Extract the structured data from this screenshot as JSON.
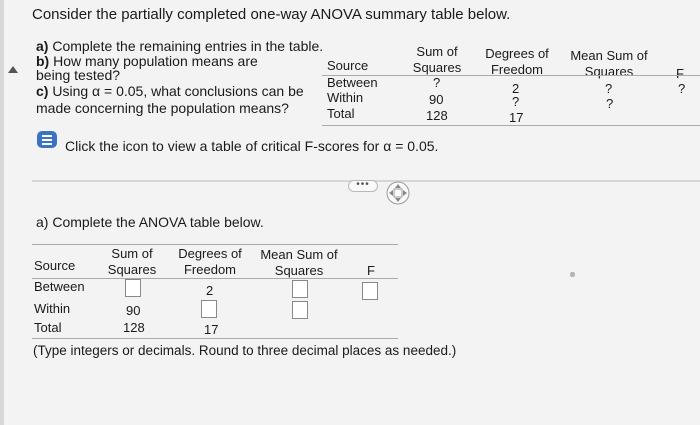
{
  "question": {
    "title": "Consider the partially completed one-way ANOVA summary table below.",
    "part_a_label": "a)",
    "part_a": "Complete the remaining entries in the table.",
    "part_b_label": "b)",
    "part_b_1": "How many population means are",
    "part_b_2": "being tested?",
    "part_c_label": "c)",
    "part_c_1": "Using α = 0.05, what conclusions can be",
    "part_c_2": "made concerning the population means?"
  },
  "summary_table": {
    "col_source": "Source",
    "col_ss_1": "Sum of",
    "col_ss_2": "Squares",
    "col_df_1": "Degrees of",
    "col_df_2": "Freedom",
    "col_ms_1": "Mean Sum of",
    "col_ms_2": "Squares",
    "col_f": "F",
    "rows": [
      {
        "source": "Between",
        "ss": "?",
        "df": "2",
        "ms": "?",
        "f": "?"
      },
      {
        "source": "Within",
        "ss": "90",
        "df": "?",
        "ms": "?"
      },
      {
        "source": "Total",
        "ss": "128",
        "df": "17"
      }
    ]
  },
  "info": {
    "icon": "table-icon",
    "text": "Click the icon to view a table of critical F-scores for α = 0.05."
  },
  "toolbar": {
    "dots_label": "•••",
    "move_icon": "move-icon"
  },
  "answer": {
    "title": "a) Complete the ANOVA table below.",
    "col_source": "Source",
    "col_ss_1": "Sum of",
    "col_ss_2": "Squares",
    "col_df_1": "Degrees of",
    "col_df_2": "Freedom",
    "col_ms_1": "Mean Sum of",
    "col_ms_2": "Squares",
    "col_f": "F",
    "row_between": "Between",
    "row_within": "Within",
    "row_total": "Total",
    "between_df": "2",
    "within_ss": "90",
    "total_ss": "128",
    "total_df": "17",
    "note": "(Type integers or decimals. Round to three decimal places as needed.)"
  }
}
